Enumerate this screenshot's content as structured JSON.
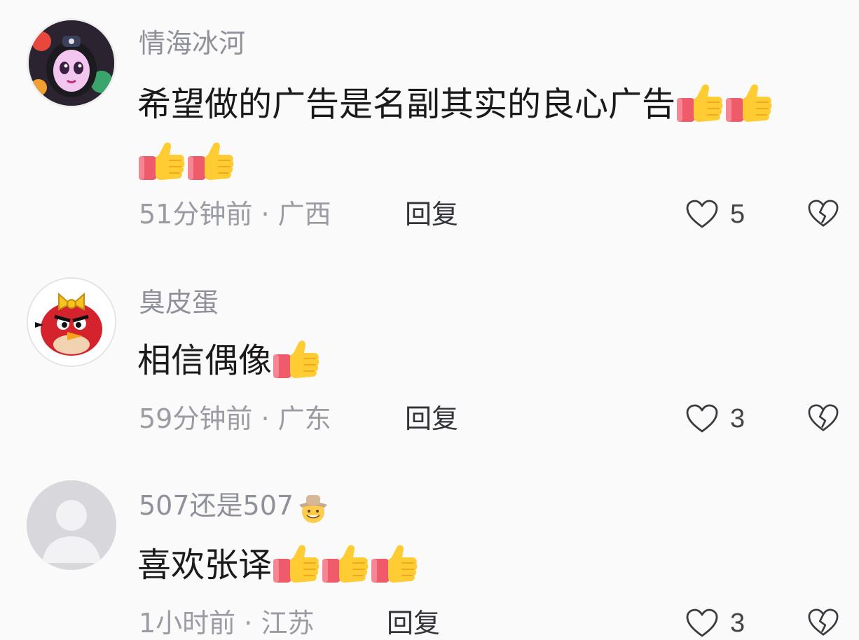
{
  "comments": [
    {
      "username": "情海冰河",
      "text": "希望做的广告是名副其实的良心广告",
      "thumbs_count": 4,
      "time": "51分钟前",
      "separator": "·",
      "location": "广西",
      "reply_label": "回复",
      "likes": "5",
      "avatar": "girl-avatar-icon"
    },
    {
      "username": "臭皮蛋",
      "text": "相信偶像",
      "thumbs_count": 1,
      "time": "59分钟前",
      "separator": "·",
      "location": "广东",
      "reply_label": "回复",
      "likes": "3",
      "avatar": "angry-bird-avatar-icon"
    },
    {
      "username": "507还是507",
      "username_emoji": "cowboy-emoji-icon",
      "text": "喜欢张译",
      "thumbs_count": 3,
      "time": "1小时前",
      "separator": "·",
      "location": "江苏",
      "reply_label": "回复",
      "likes": "3",
      "avatar": "default-avatar-icon"
    }
  ],
  "colors": {
    "background": "#fafafb",
    "username": "#8f9099",
    "meta": "#9a9ba3",
    "text": "#1a1a1a",
    "thumb_yellow": "#ffcc33",
    "sleeve_red": "#ef5b6b"
  }
}
